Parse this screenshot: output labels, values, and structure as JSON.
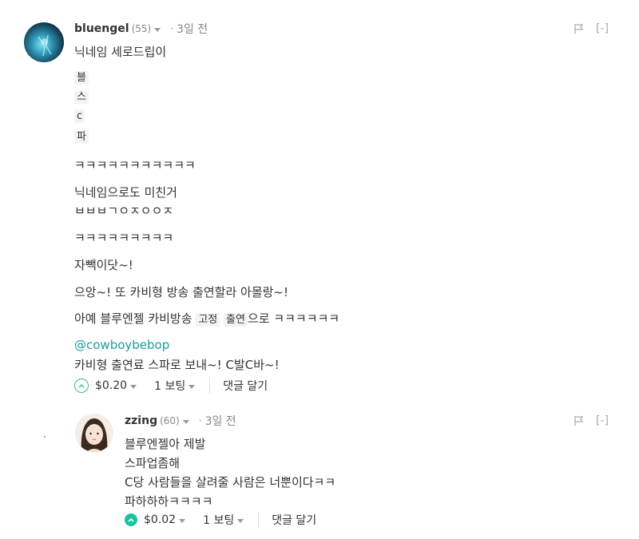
{
  "comment1": {
    "author": "bluengel",
    "reputation": "(55)",
    "time": "3일 전",
    "flag_label": "[-]",
    "lines": [
      "닉네임 세로드립이",
      "블",
      "스",
      "c",
      "파",
      "ㅋㅋㅋㅋㅋㅋㅋㅋㅋㅋㅋ",
      "닉네임으로도 미친거",
      "ㅂㅂㅂㄱㅇㅈㅇㅇㅈ",
      "ㅋㅋㅋㅋㅋㅋㅋㅋㅋ",
      "자빽이닷~!",
      "으앙~! 또 카비형 방송 출연할라 아몰랑~!"
    ],
    "line_fixed": {
      "a": "아예 블루엔젤 카비방송 ",
      "b": "고정",
      "c": " ",
      "d": "출연",
      "e": "으로 ㅋㅋㅋㅋㅋㅋ"
    },
    "mention": "@cowboybebop",
    "last_line": "카비형 출연료 스파로 보내~! C발C바~!",
    "payout": "$0.20",
    "votes": "1 보팅",
    "reply": "댓글 달기"
  },
  "comment2": {
    "author": "zzing",
    "reputation": "(60)",
    "time": "3일 전",
    "flag_label": "[-]",
    "lines": [
      "블루엔젤아 제발",
      "스파업좀해",
      "C당 사람들을 살려줄 사람은 너뿐이다ㅋㅋ",
      "파하하하ㅋㅋㅋㅋ"
    ],
    "payout": "$0.02",
    "votes": "1 보팅",
    "reply": "댓글 달기"
  },
  "colors": {
    "accent": "#18c3a0",
    "link": "#1a9c9c"
  }
}
